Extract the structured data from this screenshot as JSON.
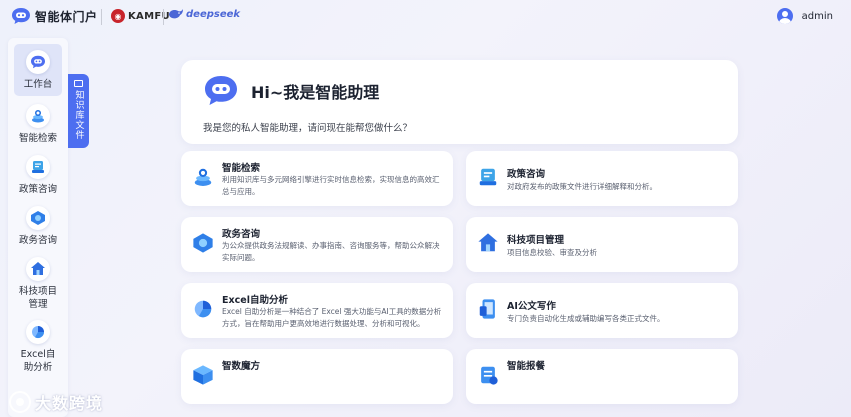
{
  "header": {
    "brand_title": "智能体门户",
    "partner1": "KAMFU",
    "partner2": "deepseek",
    "user_name": "admin"
  },
  "sidebar": {
    "items": [
      {
        "label": "工作台",
        "icon": "chat-bot-icon",
        "active": true
      },
      {
        "label": "智能检索",
        "icon": "search-stack-icon"
      },
      {
        "label": "政策咨询",
        "icon": "policy-doc-icon"
      },
      {
        "label": "政务咨询",
        "icon": "gov-service-icon"
      },
      {
        "label": "科技项目管理",
        "icon": "project-house-icon"
      },
      {
        "label": "Excel自助分析",
        "icon": "pie-chart-icon"
      }
    ],
    "knowledge_tab": "知识库文件"
  },
  "hero": {
    "title": "Hi~我是智能助理",
    "subtitle": "我是您的私人智能助理，请问现在能帮您做什么？"
  },
  "cards": [
    {
      "title": "智能检索",
      "desc": "利用知识库与多元网络引擎进行实时信息检索，实现信息的高效汇总与应用。",
      "icon": "search-stack-icon"
    },
    {
      "title": "政策咨询",
      "desc": "对政府发布的政策文件进行详细解释和分析。",
      "icon": "policy-doc-icon"
    },
    {
      "title": "政务咨询",
      "desc": "为公众提供政务法规解读、办事指南、咨询服务等，帮助公众解决实际问题。",
      "icon": "gov-service-icon"
    },
    {
      "title": "科技项目管理",
      "desc": "项目信息校验、审查及分析",
      "icon": "project-house-icon"
    },
    {
      "title": "Excel自助分析",
      "desc": "Excel 自助分析是一种结合了 Excel 强大功能与AI工具的数据分析方式，旨在帮助用户更高效地进行数据处理、分析和可视化。",
      "icon": "pie-chart-icon"
    },
    {
      "title": "AI公文写作",
      "desc": "专门负责自动化生成或辅助编写各类正式文件。",
      "icon": "document-phone-icon"
    },
    {
      "title": "智数魔方",
      "desc": "",
      "icon": "cube-icon"
    },
    {
      "title": "智能报餐",
      "desc": "",
      "icon": "meal-order-icon"
    }
  ],
  "watermark": "大数跨境",
  "colors": {
    "accent": "#4d6ef0",
    "kamfu_red": "#c8242b"
  }
}
